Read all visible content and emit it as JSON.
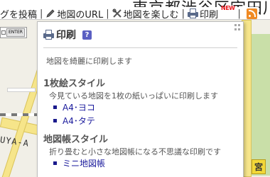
{
  "toolbar": {
    "city_title": "東京都渋谷区宇田川",
    "items": [
      {
        "label": "グを投稿",
        "icon": "map-icon"
      },
      {
        "label": "地図のURL",
        "icon": "pen-icon"
      },
      {
        "label": "地図を楽しむ",
        "icon": "tools-icon"
      },
      {
        "label": "印刷",
        "icon": "printer-icon",
        "badge": "NEW"
      }
    ],
    "separator": "|"
  },
  "map_control": {
    "button_label": "ENTER"
  },
  "map": {
    "label_left": "UYA-A",
    "label_right": "宮"
  },
  "print_panel": {
    "title": "印刷",
    "help_label": "?",
    "intro": "地図を綺麗に印刷します",
    "sections": [
      {
        "heading": "1枚絵スタイル",
        "description": "今見ている地図を1枚の紙いっぱいに印刷します",
        "options": [
          "A4･ヨコ",
          "A4･タテ"
        ]
      },
      {
        "heading": "地図帳スタイル",
        "description": "折り畳むと小さな地図帳になる不思議な印刷です",
        "options": [
          "ミニ地図帳"
        ]
      }
    ]
  },
  "colors": {
    "link": "#1a1a9c",
    "help_icon": "#5a5fc2",
    "new_badge": "#e8151b",
    "rss": "#f08a24"
  }
}
